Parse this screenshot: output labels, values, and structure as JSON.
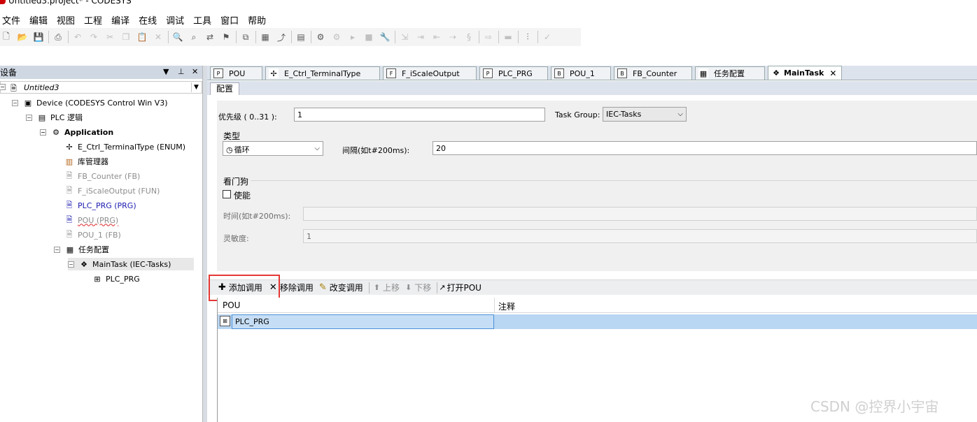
{
  "window": {
    "title": "Untitled3.project* - CODESYS"
  },
  "menu": [
    "文件",
    "编辑",
    "视图",
    "工程",
    "编译",
    "在线",
    "调试",
    "工具",
    "窗口",
    "帮助"
  ],
  "toolbar_icons": [
    "new-file-icon",
    "open-folder-icon",
    "save-icon",
    "print-icon",
    "undo-icon",
    "redo-icon",
    "cut-icon",
    "copy-icon",
    "paste-icon",
    "delete-icon",
    "find-icon",
    "find-next-icon",
    "replace-icon",
    "bookmark-icon",
    "copy-window-icon",
    "add-object-icon",
    "properties-icon",
    "build-icon",
    "login-icon",
    "logout-icon",
    "start-icon",
    "stop-icon",
    "tools-icon",
    "step-into-icon",
    "step-over-icon",
    "step-out-icon",
    "run-to-cursor-icon",
    "breakpoint-icon",
    "next-statement-icon",
    "toggle-icon",
    "filter-icon",
    "check-icon"
  ],
  "devices_pane": {
    "title": "设备",
    "root": "Untitled3",
    "tree": [
      {
        "label": "Device (CODESYS Control Win V3)",
        "icon": "device-icon",
        "style": "normal"
      },
      {
        "label": "PLC 逻辑",
        "icon": "plc-logic-icon",
        "style": "normal"
      },
      {
        "label": "Application",
        "icon": "application-gear-icon",
        "style": "bold"
      },
      {
        "label": "E_Ctrl_TerminalType (ENUM)",
        "icon": "enum-icon",
        "style": "normal"
      },
      {
        "label": "库管理器",
        "icon": "library-icon",
        "style": "normal"
      },
      {
        "label": "FB_Counter (FB)",
        "icon": "fb-icon",
        "style": "gray"
      },
      {
        "label": "F_iScaleOutput (FUN)",
        "icon": "function-icon",
        "style": "gray"
      },
      {
        "label": "PLC_PRG (PRG)",
        "icon": "program-icon",
        "style": "blue"
      },
      {
        "label": "POU (PRG)",
        "icon": "program-icon",
        "style": "gray-squiggle"
      },
      {
        "label": "POU_1 (FB)",
        "icon": "fb-icon",
        "style": "gray"
      },
      {
        "label": "任务配置",
        "icon": "task-config-icon",
        "style": "normal"
      },
      {
        "label": "MainTask (IEC-Tasks)",
        "icon": "task-icon",
        "style": "selected"
      },
      {
        "label": "PLC_PRG",
        "icon": "program-call-icon",
        "style": "normal"
      }
    ]
  },
  "editor_tabs": [
    {
      "label": "POU",
      "icon": "program-icon",
      "active": false
    },
    {
      "label": "E_Ctrl_TerminalType",
      "icon": "enum-icon",
      "active": false
    },
    {
      "label": "F_iScaleOutput",
      "icon": "function-icon",
      "active": false
    },
    {
      "label": "PLC_PRG",
      "icon": "program-icon",
      "active": false
    },
    {
      "label": "POU_1",
      "icon": "fb-icon",
      "active": false
    },
    {
      "label": "FB_Counter",
      "icon": "fb-icon",
      "active": false
    },
    {
      "label": "任务配置",
      "icon": "task-config-icon",
      "active": false
    },
    {
      "label": "MainTask",
      "icon": "task-icon",
      "active": true
    }
  ],
  "subtab": "配置",
  "config": {
    "priority_label": "优先级 ( 0..31 ):",
    "priority_value": "1",
    "task_group_label": "Task Group:",
    "task_group_value": "IEC-Tasks",
    "type_label": "类型",
    "type_value": "循环",
    "interval_label": "间隔(如t#200ms):",
    "interval_value": "20",
    "watchdog_label": "看门狗",
    "enable_label": "使能",
    "enable_checked": false,
    "time_label": "时间(如t#200ms):",
    "time_value": "",
    "sensitivity_label": "灵敏度:",
    "sensitivity_value": "1"
  },
  "call_toolbar": {
    "add_call": "添加调用",
    "remove_call": "移除调用",
    "change_call": "改变调用",
    "move_up": "上移",
    "move_down": "下移",
    "open_pou": "打开POU"
  },
  "calls_table": {
    "columns": [
      "POU",
      "注释"
    ],
    "rows": [
      {
        "pou": "PLC_PRG",
        "comment": ""
      }
    ]
  },
  "watermark": "CSDN @控界小宇宙",
  "colors": {
    "accent_selection": "#b9d6f2",
    "highlight_box": "#e53935",
    "pane_header": "#cfd7e2"
  }
}
